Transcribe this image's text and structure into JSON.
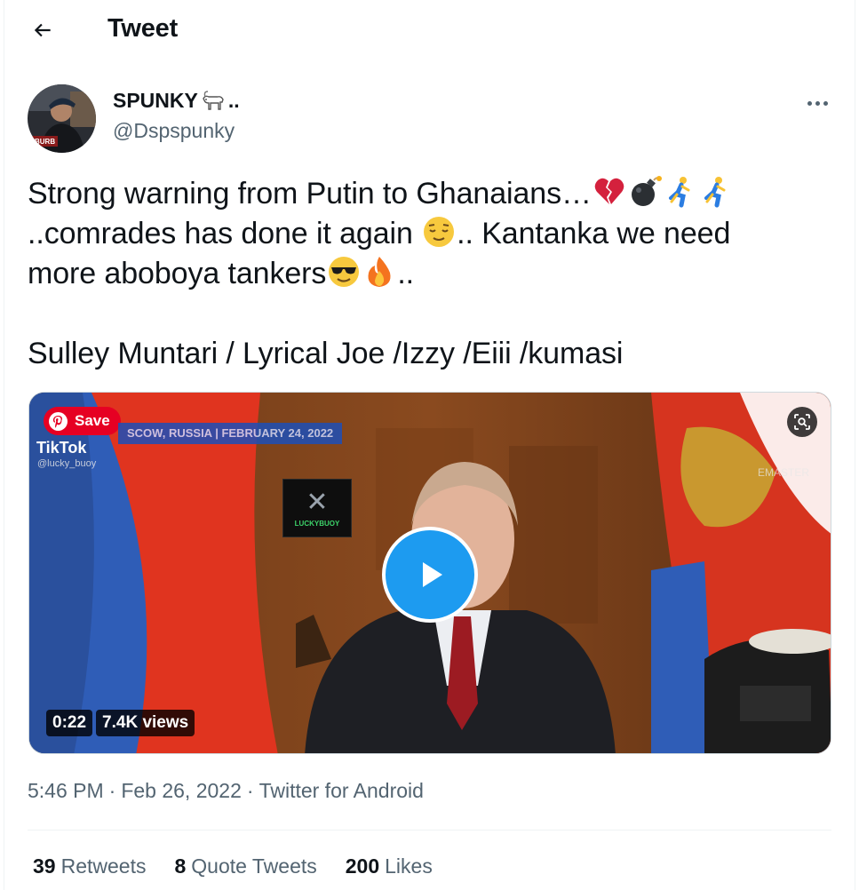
{
  "header": {
    "title": "Tweet",
    "back_icon": "arrow-left-icon"
  },
  "author": {
    "display_name": "SPUNKY",
    "display_name_suffix": "..",
    "name_emoji": "goat-icon",
    "handle": "@Dspspunky"
  },
  "tweet": {
    "line1": "Strong warning from Putin to Ghanaians…",
    "line1_emojis": [
      "broken-heart-icon",
      "bomb-icon",
      "person-running-icon",
      "person-running-icon"
    ],
    "line2a": "..comrades has done it again ",
    "line2_emoji": "relieved-face-icon",
    "line2b": ".. Kantanka we need",
    "line3a": "more aboboya tankers",
    "line3_emojis": [
      "sunglasses-face-icon",
      "fire-icon"
    ],
    "line3b": "..",
    "line4": "Sulley Muntari / Lyrical Joe /Izzy /Eiii /kumasi"
  },
  "media": {
    "pinterest_save": "Save",
    "overlay_strip": "SCOW, RUSSIA | FEBRUARY 24, 2022",
    "tiktok_label": "TikTok",
    "tiktok_handle": "@lucky_buoy",
    "watermark": "EMASTER",
    "logo_text": "LUCKYBUOY",
    "duration": "0:22",
    "views": "7.4K views"
  },
  "meta": {
    "time": "5:46 PM",
    "separator": "·",
    "date": "Feb 26, 2022",
    "source": "Twitter for Android"
  },
  "stats": {
    "retweets_count": "39",
    "retweets_label": "Retweets",
    "quotes_count": "8",
    "quotes_label": "Quote Tweets",
    "likes_count": "200",
    "likes_label": "Likes"
  },
  "colors": {
    "accent": "#1d9bf0",
    "secondary_text": "#536471",
    "pinterest": "#e60023"
  }
}
